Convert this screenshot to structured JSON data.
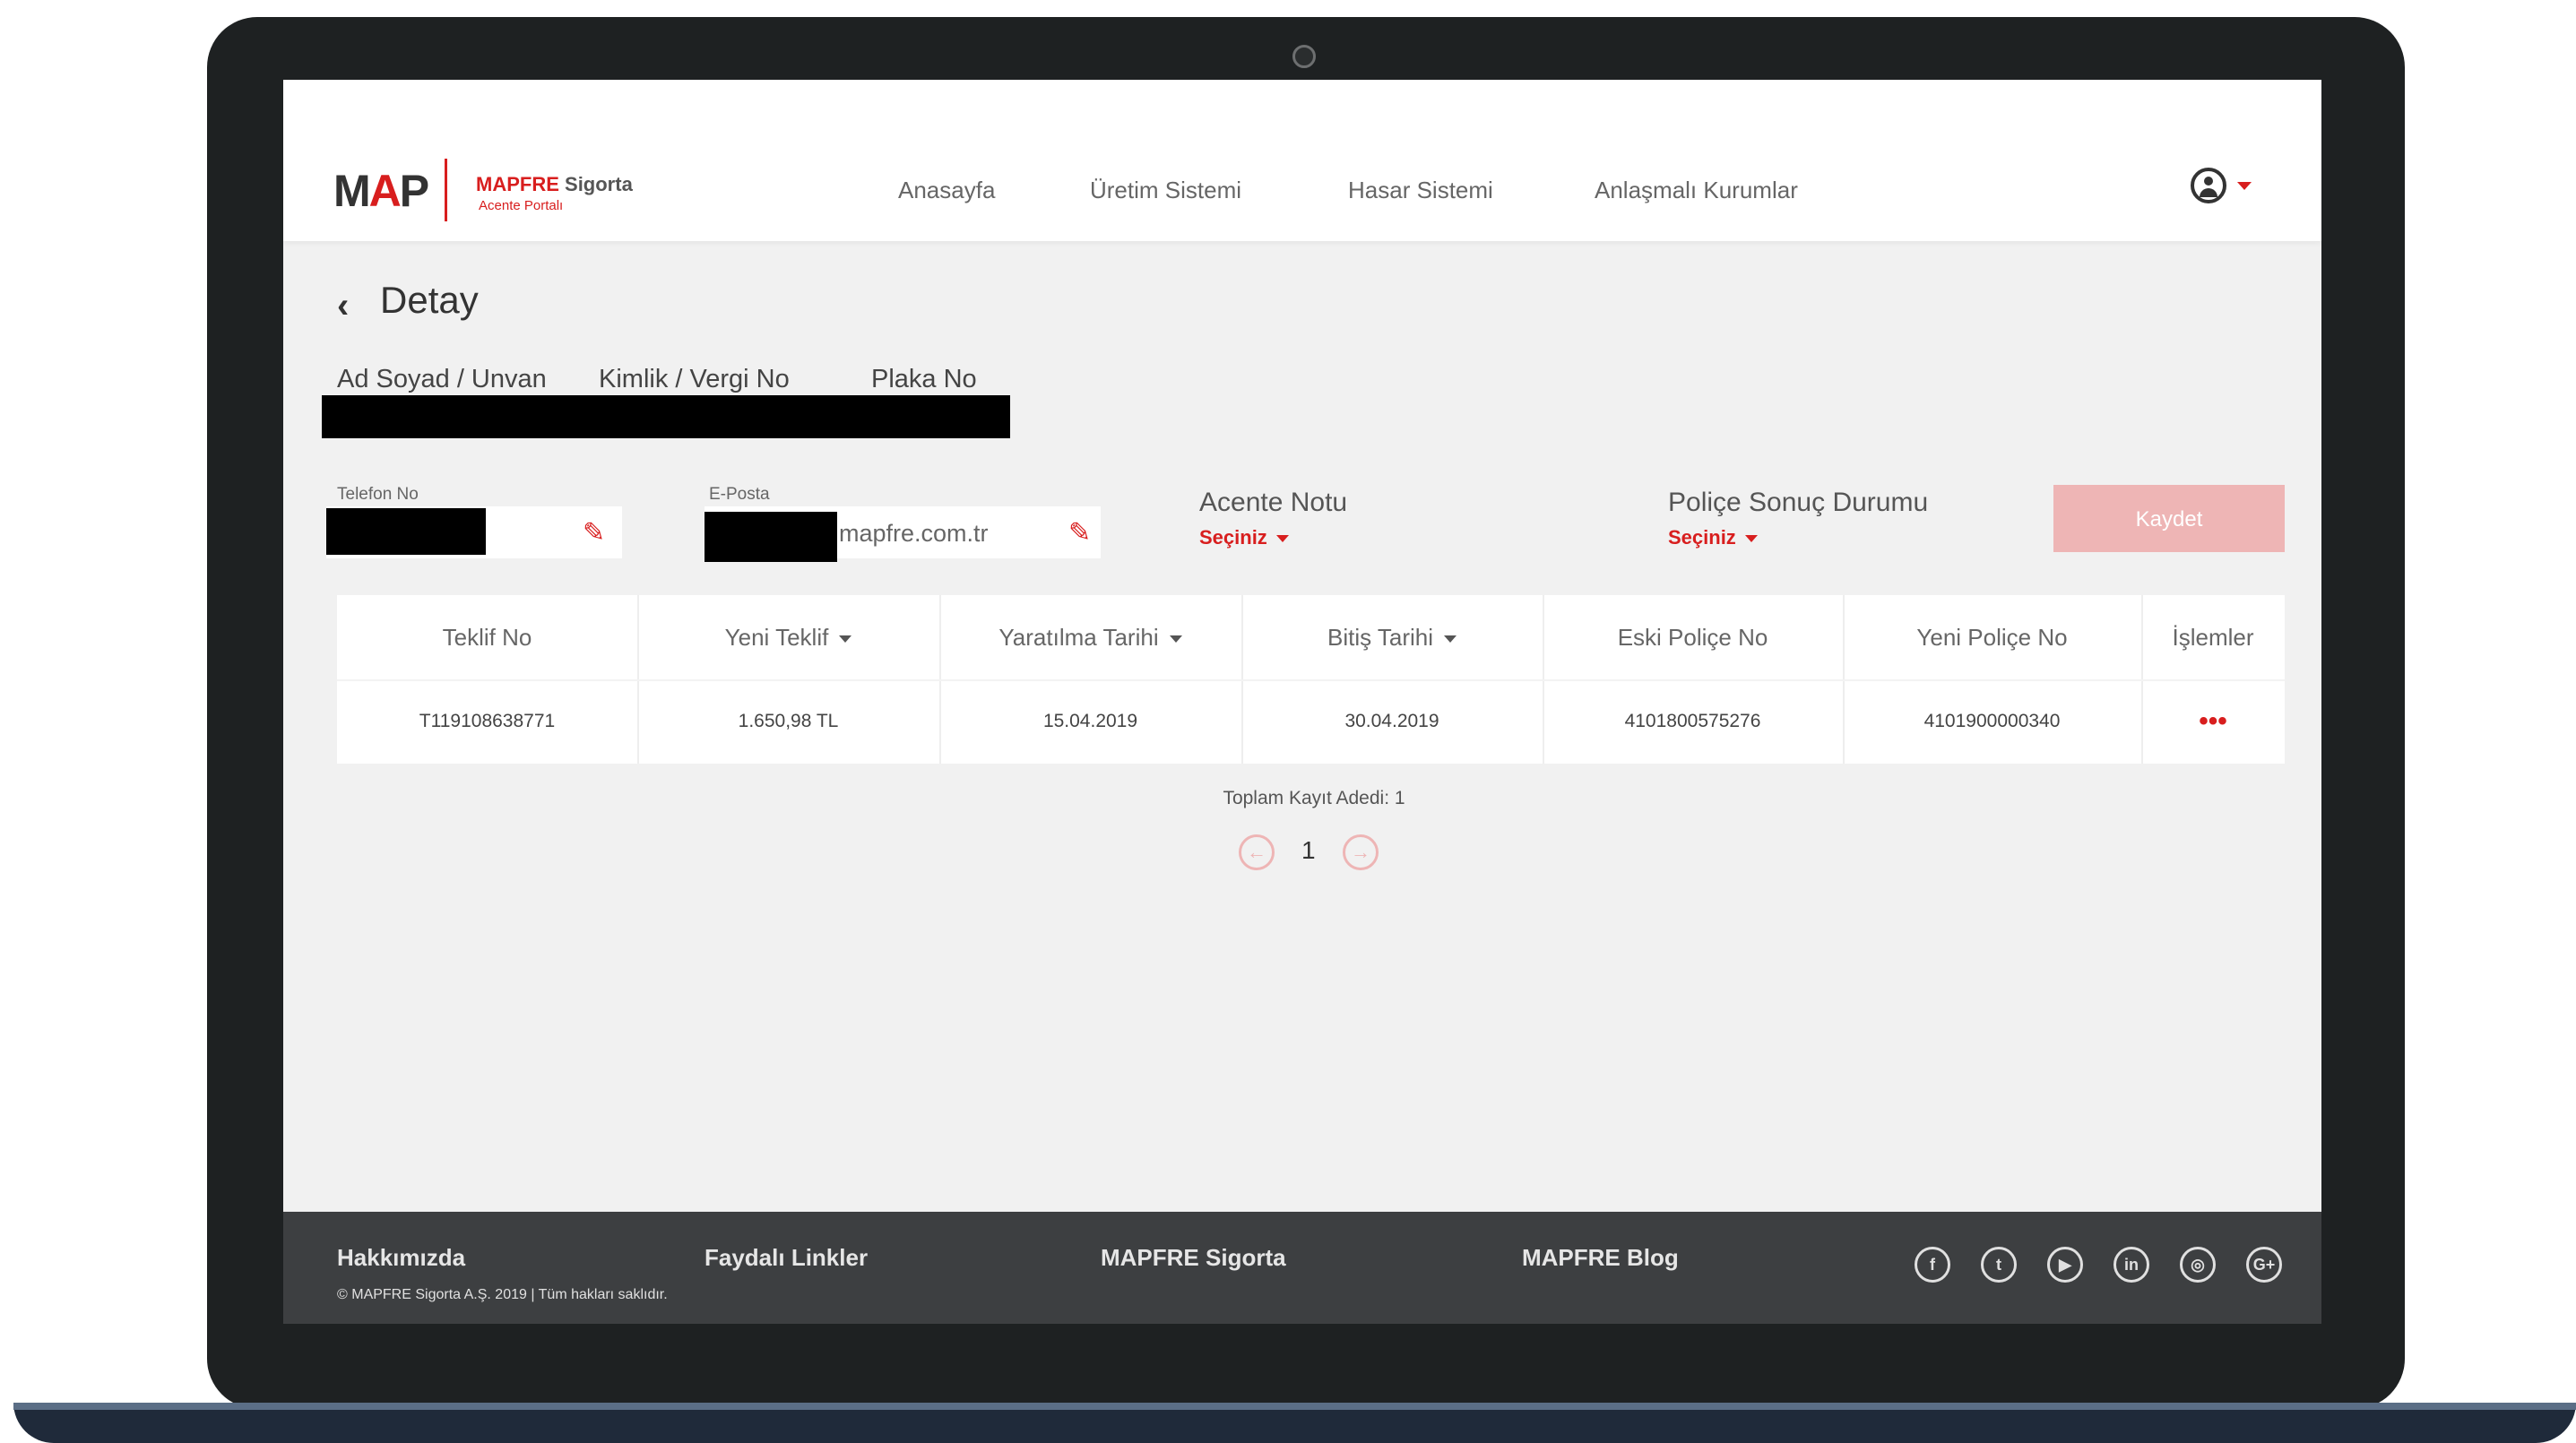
{
  "header": {
    "logo_map_pre": "M",
    "logo_map_a": "A",
    "logo_map_post": "P",
    "logo_brand": "MAPFRE",
    "logo_brand_suffix": "Sigorta",
    "logo_sub": "Acente Portalı",
    "nav": [
      "Anasayfa",
      "Üretim Sistemi",
      "Hasar Sistemi",
      "Anlaşmalı Kurumlar"
    ],
    "user_icon": "user-circle-icon"
  },
  "page": {
    "back_icon": "‹",
    "title": "Detay",
    "labels": {
      "name": "Ad Soyad / Unvan",
      "tax_id": "Kimlik / Vergi No",
      "plate": "Plaka No"
    }
  },
  "form": {
    "phone_label": "Telefon No",
    "email_label": "E-Posta",
    "email_value_visible": "mapfre.com.tr",
    "agent_note_title": "Acente Notu",
    "agent_note_value": "Seçiniz",
    "policy_result_title": "Poliçe Sonuç Durumu",
    "policy_result_value": "Seçiniz",
    "save_label": "Kaydet"
  },
  "table": {
    "columns": [
      "Teklif No",
      "Yeni Teklif",
      "Yaratılma Tarihi",
      "Bitiş Tarihi",
      "Eski Poliçe No",
      "Yeni Poliçe No",
      "İşlemler"
    ],
    "rows": [
      [
        "T119108638771",
        "1.650,98 TL",
        "15.04.2019",
        "30.04.2019",
        "4101800575276",
        "4101900000340",
        "•••"
      ]
    ]
  },
  "pagination": {
    "total": "Toplam Kayıt Adedi: 1",
    "current_page": "1"
  },
  "footer": {
    "links": [
      "Hakkımızda",
      "Faydalı Linkler",
      "MAPFRE Sigorta",
      "MAPFRE Blog"
    ],
    "copyright": "© MAPFRE Sigorta A.Ş. 2019 | Tüm hakları saklıdır.",
    "social": [
      {
        "name": "facebook-icon",
        "glyph": "f"
      },
      {
        "name": "twitter-icon",
        "glyph": "t"
      },
      {
        "name": "youtube-icon",
        "glyph": "▶"
      },
      {
        "name": "linkedin-icon",
        "glyph": "in"
      },
      {
        "name": "instagram-icon",
        "glyph": "◎"
      },
      {
        "name": "google-plus-icon",
        "glyph": "G+"
      }
    ]
  },
  "colors": {
    "brand_red": "#d81e1e",
    "button_disabled": "#eeb5b5",
    "footer_bg": "#3d3f41"
  }
}
